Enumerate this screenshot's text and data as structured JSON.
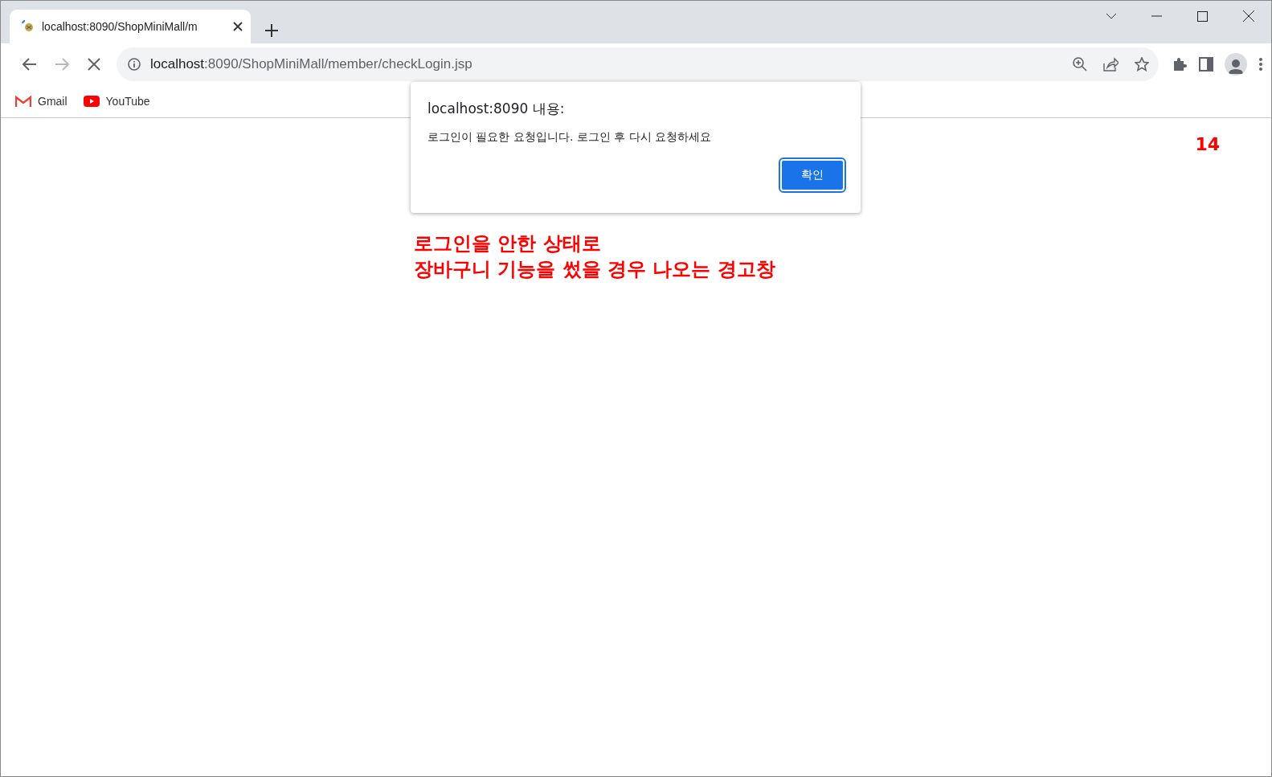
{
  "window": {
    "tab_title": "localhost:8090/ShopMiniMall/m"
  },
  "toolbar": {
    "url_host": "localhost",
    "url_rest": ":8090/ShopMiniMall/member/checkLogin.jsp"
  },
  "bookmarks": [
    {
      "kind": "gmail",
      "label": "Gmail"
    },
    {
      "kind": "youtube",
      "label": "YouTube"
    }
  ],
  "dialog": {
    "title": "localhost:8090 내용:",
    "message": "로그인이 필요한 요청입니다. 로그인 후 다시 요청하세요",
    "button": "확인"
  },
  "page": {
    "number": "14",
    "annotation": [
      "로그인을 안한 상태로",
      "장바구니 기능을 썼을 경우 나오는 경고창"
    ]
  }
}
